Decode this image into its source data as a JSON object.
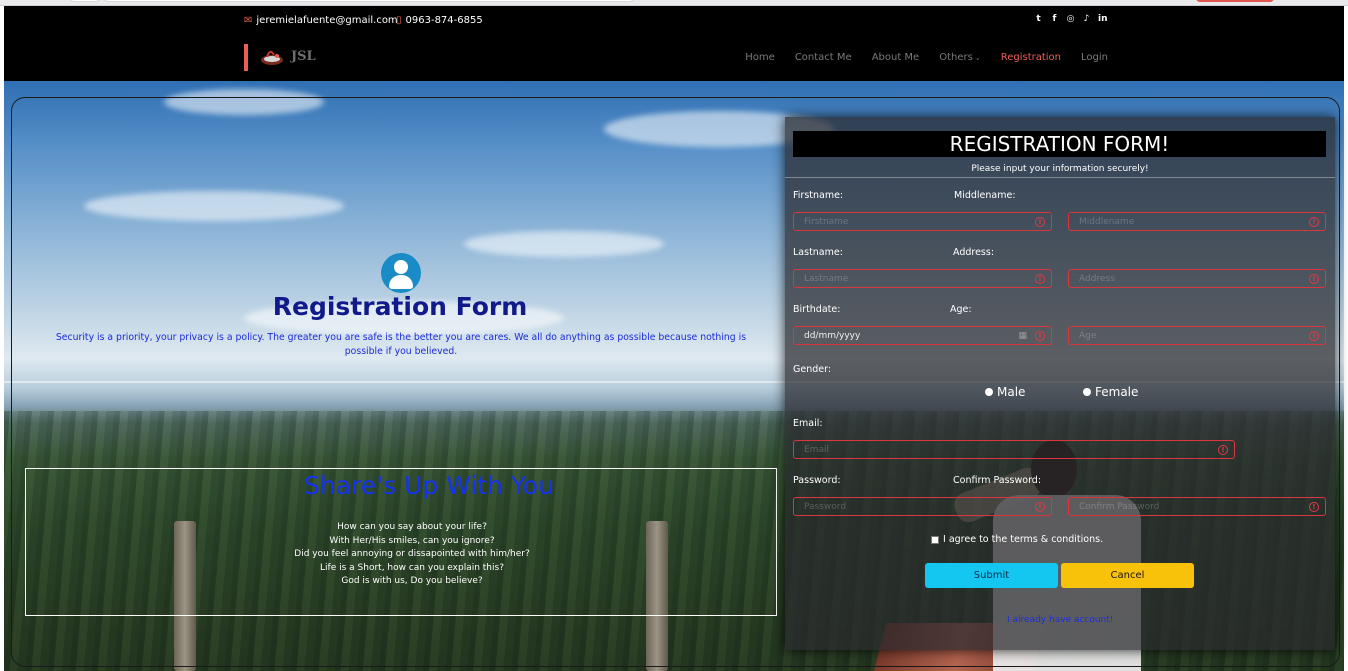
{
  "topbar": {
    "email": "jeremielafuente@gmail.com",
    "phone": "0963-874-6855",
    "social_icons": [
      "twitter-icon",
      "facebook-icon",
      "instagram-icon",
      "tiktok-icon",
      "linkedin-icon"
    ]
  },
  "header": {
    "logo_text": "JSL",
    "nav": [
      {
        "label": "Home",
        "active": false
      },
      {
        "label": "Contact Me",
        "active": false
      },
      {
        "label": "About Me",
        "active": false
      },
      {
        "label": "Others",
        "active": false,
        "dropdown": true
      },
      {
        "label": "Registration",
        "active": true
      },
      {
        "label": "Login",
        "active": false
      }
    ]
  },
  "hero": {
    "title": "Registration Form",
    "description": "Security is a priority, your privacy is a policy. The greater you are safe is the better you are cares. We all do anything as possible because nothing is possible if you believed.",
    "share_title": "Share's Up With You",
    "poem": [
      "How can you say about your life?",
      "With Her/His smiles, can you ignore?",
      "Did you feel annoying or dissapointed with him/her?",
      "Life is a Short, how can you explain this?",
      "God is with us, Do you believe?"
    ]
  },
  "form": {
    "title": "REGISTRATION FORM!",
    "subtitle": "Please input your information securely!",
    "labels": {
      "firstname": "Firstname:",
      "middlename": "Middlename:",
      "lastname": "Lastname:",
      "address": "Address:",
      "birthdate": "Birthdate:",
      "age": "Age:",
      "gender": "Gender:",
      "email": "Email:",
      "password": "Password:",
      "confirm_password": "Confirm Password:"
    },
    "placeholders": {
      "firstname": "Firstname",
      "middlename": "Middlename",
      "lastname": "Lastname",
      "address": "Address",
      "birthdate": "dd/mm/yyyy",
      "age": "Age",
      "email": "Email",
      "password": "Password",
      "confirm_password": "Confirm Password"
    },
    "gender_options": [
      "Male",
      "Female"
    ],
    "terms_label": "I agree to the terms & conditions.",
    "submit_label": "Submit",
    "cancel_label": "Cancel",
    "account_link": "I already have account!"
  },
  "colors": {
    "accent": "#e95f56",
    "submit": "#13c7f0",
    "cancel": "#f8c20a",
    "field_border": "#d9363e",
    "hero_title": "#111a8a",
    "share_title": "#1533ef"
  }
}
